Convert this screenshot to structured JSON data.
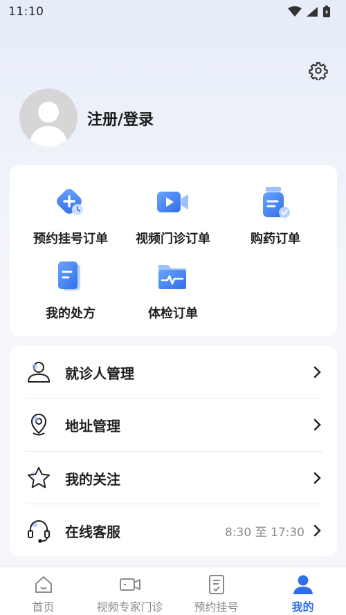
{
  "status_bar": {
    "time": "11:10"
  },
  "profile": {
    "login_text": "注册/登录"
  },
  "orders": [
    {
      "label": "预约挂号订单"
    },
    {
      "label": "视频门诊订单"
    },
    {
      "label": "购药订单"
    },
    {
      "label": "我的处方"
    },
    {
      "label": "体检订单"
    }
  ],
  "menu": [
    {
      "label": "就诊人管理",
      "icon": "person-icon"
    },
    {
      "label": "地址管理",
      "icon": "location-pin-icon"
    },
    {
      "label": "我的关注",
      "icon": "star-icon"
    },
    {
      "label": "在线客服",
      "icon": "headset-icon",
      "extra": "8:30 至 17:30"
    }
  ],
  "tabbar": [
    {
      "label": "首页"
    },
    {
      "label": "视频专家门诊"
    },
    {
      "label": "预约挂号"
    },
    {
      "label": "我的",
      "active": true
    }
  ],
  "colors": {
    "accent": "#2f6fe8",
    "icon_blue": "#4a86f7"
  }
}
